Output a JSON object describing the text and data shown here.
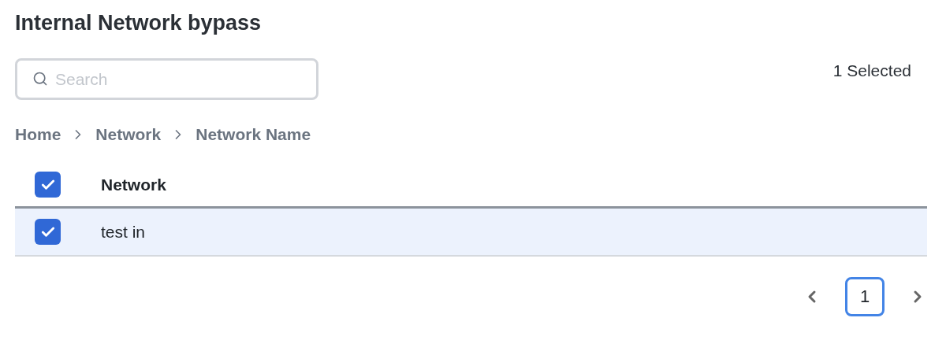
{
  "title": "Internal Network bypass",
  "search": {
    "placeholder": "Search"
  },
  "selection_count": "1 Selected",
  "breadcrumb": [
    "Home",
    "Network",
    "Network Name"
  ],
  "table": {
    "select_all_checked": true,
    "columns": [
      "Network"
    ],
    "rows": [
      {
        "cells": [
          "test in"
        ],
        "checked": true,
        "selected": true
      }
    ]
  },
  "pagination": {
    "pages": [
      {
        "label": "1",
        "selected": true
      }
    ]
  }
}
